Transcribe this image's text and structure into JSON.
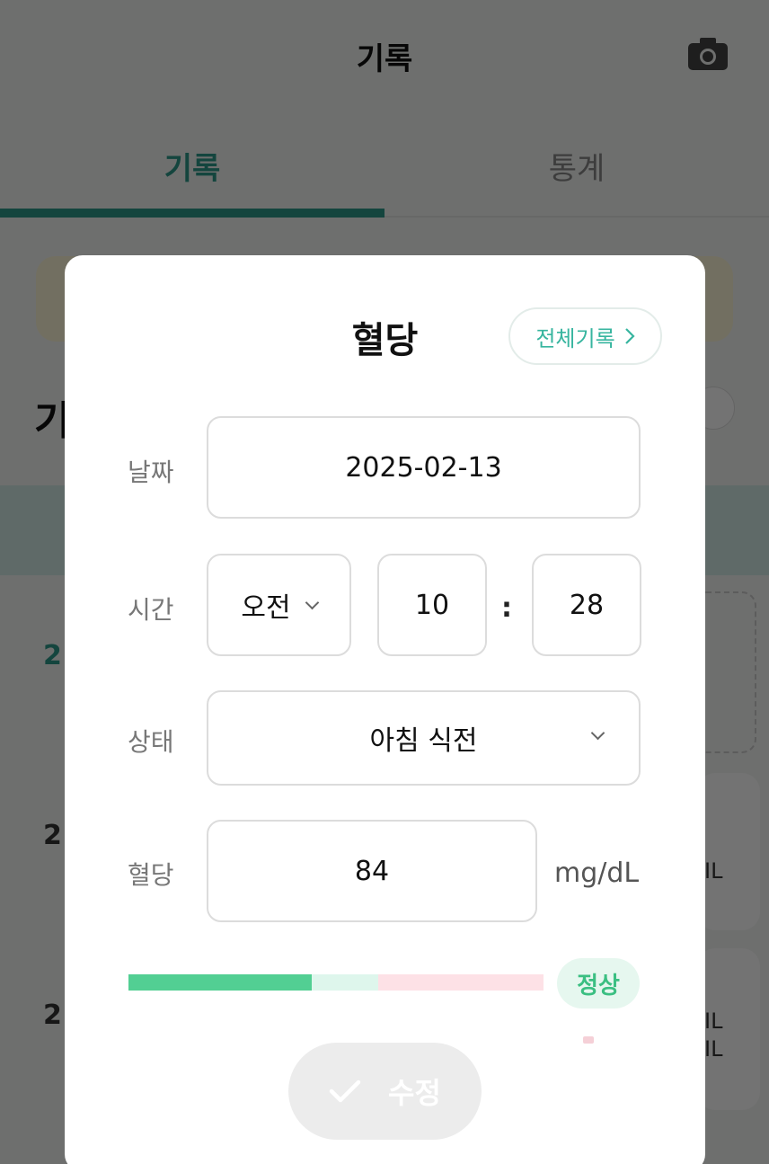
{
  "header": {
    "title": "기록",
    "camera_icon": "camera-icon"
  },
  "tabs": [
    {
      "label": "기록",
      "active": true
    },
    {
      "label": "통계",
      "active": false
    }
  ],
  "background": {
    "section_title_fragment": "기",
    "rows": [
      {
        "date_fragment": "2"
      },
      {
        "date_fragment": "2"
      },
      {
        "date_fragment": "2"
      }
    ],
    "unit_fragments": [
      "IL",
      "IL",
      "IL"
    ]
  },
  "modal": {
    "title": "혈당",
    "history_button": {
      "label": "전체기록",
      "icon": "chevron-right-icon"
    },
    "date": {
      "label": "날짜",
      "value": "2025-02-13"
    },
    "time": {
      "label": "시간",
      "ampm": "오전",
      "hour": "10",
      "separator": ":",
      "minute": "28"
    },
    "state": {
      "label": "상태",
      "value": "아침 식전"
    },
    "glucose": {
      "label": "혈당",
      "value": "84",
      "unit": "mg/dL"
    },
    "status": {
      "label": "정상"
    },
    "submit": {
      "label": "수정",
      "icon": "check-icon"
    }
  },
  "colors": {
    "accent": "#2e9a8a",
    "teal_text": "#37b59f",
    "normal_green": "#52cf93",
    "normal_light": "#def6ec",
    "high_pink": "#fde1e6",
    "overlay": "rgba(0,0,0,0.55)"
  }
}
